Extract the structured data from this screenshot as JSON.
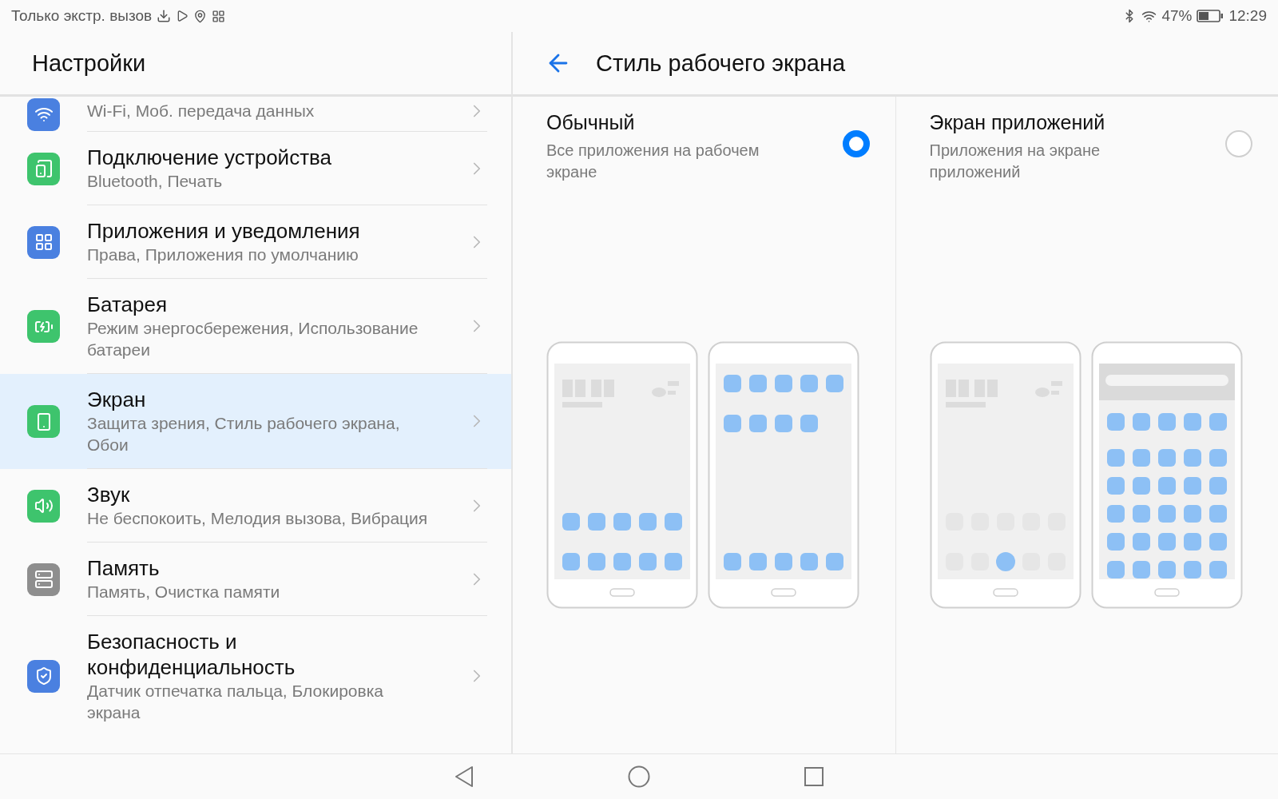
{
  "status_bar": {
    "notice": "Только экстр. вызов",
    "battery_text": "47%",
    "time": "12:29"
  },
  "sidebar": {
    "title": "Настройки",
    "items": [
      {
        "kind": "wifi",
        "color": "#4a80e0",
        "subtitle": "Wi-Fi, Моб. передача данных",
        "selected": false
      },
      {
        "kind": "devices",
        "color": "#3ec46d",
        "title": "Подключение устройства",
        "subtitle": "Bluetooth, Печать",
        "selected": false
      },
      {
        "kind": "apps",
        "color": "#4a80e0",
        "title": "Приложения и уведомления",
        "subtitle": "Права, Приложения по умолчанию",
        "selected": false
      },
      {
        "kind": "battery",
        "color": "#3ec46d",
        "title": "Батарея",
        "subtitle": "Режим энергосбережения, Использование батареи",
        "selected": false
      },
      {
        "kind": "screen",
        "color": "#3ec46d",
        "title": "Экран",
        "subtitle": "Защита зрения, Стиль рабочего экрана, Обои",
        "selected": true
      },
      {
        "kind": "sound",
        "color": "#3ec46d",
        "title": "Звук",
        "subtitle": "Не беспокоить, Мелодия вызова, Вибрация",
        "selected": false
      },
      {
        "kind": "memory",
        "color": "#8e8e8e",
        "title": "Память",
        "subtitle": "Память, Очистка памяти",
        "selected": false
      },
      {
        "kind": "shield",
        "color": "#4a80e0",
        "title": "Безопасность и конфиденциальность",
        "subtitle": "Датчик отпечатка пальца, Блокировка экрана",
        "selected": false
      }
    ]
  },
  "detail": {
    "title": "Стиль рабочего экрана",
    "options": [
      {
        "title": "Обычный",
        "subtitle": "Все приложения на рабочем экране",
        "selected": true,
        "previews": [
          {
            "kind": "home"
          },
          {
            "kind": "pages"
          }
        ]
      },
      {
        "title": "Экран приложений",
        "subtitle": "Приложения на экране приложений",
        "selected": false,
        "previews": [
          {
            "kind": "home-drawer"
          },
          {
            "kind": "drawer"
          }
        ]
      }
    ]
  }
}
